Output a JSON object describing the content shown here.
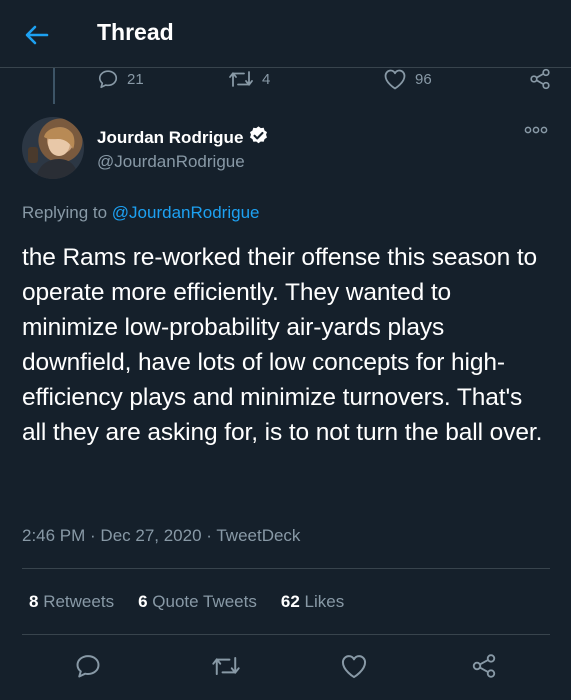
{
  "header": {
    "title": "Thread",
    "back_icon": "back-arrow-icon"
  },
  "previous_tweet": {
    "replies": "21",
    "retweets": "4",
    "likes": "96"
  },
  "tweet": {
    "author": {
      "name": "Jourdan Rodrigue",
      "handle": "@JourdanRodrigue",
      "verified": true
    },
    "replying_prefix": "Replying to",
    "replying_to": "@JourdanRodrigue",
    "text": "the Rams re-worked their offense this season to operate more efficiently. They wanted to minimize low-probability air-yards plays downfield, have lots of low concepts for high-efficiency plays and minimize turnovers. That's all they are asking for, is to not turn the ball over.",
    "meta": "2:46 PM · Dec 27, 2020 · TweetDeck",
    "counts": {
      "retweets_num": "8",
      "retweets_label": "Retweets",
      "quotes_num": "6",
      "quotes_label": "Quote Tweets",
      "likes_num": "62",
      "likes_label": "Likes"
    }
  },
  "colors": {
    "background": "#15202b",
    "accent": "#1da1f2",
    "muted_text": "#8899a6",
    "divider": "#38444d"
  }
}
